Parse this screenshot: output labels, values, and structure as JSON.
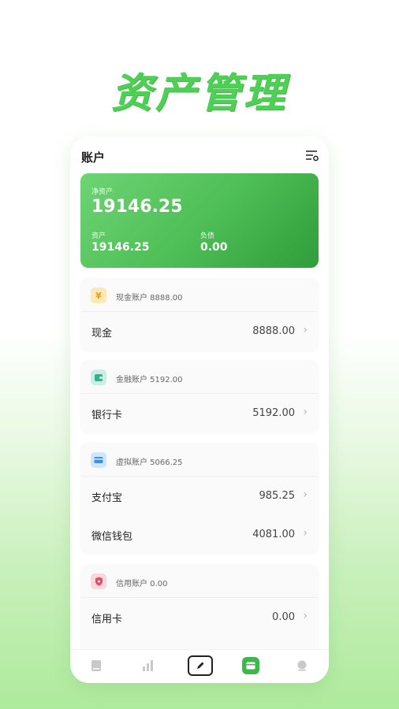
{
  "headline": "资产管理",
  "screen": {
    "title": "账户",
    "summary": {
      "net_label": "净资产",
      "net_value": "19146.25",
      "assets_label": "资产",
      "assets_value": "19146.25",
      "liabilities_label": "负债",
      "liabilities_value": "0.00"
    },
    "groups": [
      {
        "icon": "yen-icon",
        "icon_text": "¥",
        "icon_bg": "#fde9b8",
        "icon_fg": "#e0a126",
        "title": "现金账户 8888.00",
        "items": [
          {
            "name": "现金",
            "value": "8888.00"
          }
        ]
      },
      {
        "icon": "wallet-icon",
        "icon_bg": "#c9efe4",
        "icon_fg": "#2fb38b",
        "title": "金融账户 5192.00",
        "items": [
          {
            "name": "银行卡",
            "value": "5192.00"
          }
        ]
      },
      {
        "icon": "card-icon",
        "icon_bg": "#cfe6fb",
        "icon_fg": "#3b93e4",
        "title": "虚拟账户 5066.25",
        "items": [
          {
            "name": "支付宝",
            "value": "985.25"
          },
          {
            "name": "微信钱包",
            "value": "4081.00"
          }
        ]
      },
      {
        "icon": "shield-icon",
        "icon_bg": "#fbd6dc",
        "icon_fg": "#e44a61",
        "title": "信用账户 0.00",
        "items": [
          {
            "name": "信用卡",
            "value": "0.00"
          }
        ]
      }
    ],
    "nav": [
      "book-icon",
      "chart-bars-icon",
      "pen-icon",
      "account-icon",
      "user-icon"
    ],
    "colors": {
      "accent": "#4fbf57",
      "active_nav": "#3cb94a"
    }
  }
}
